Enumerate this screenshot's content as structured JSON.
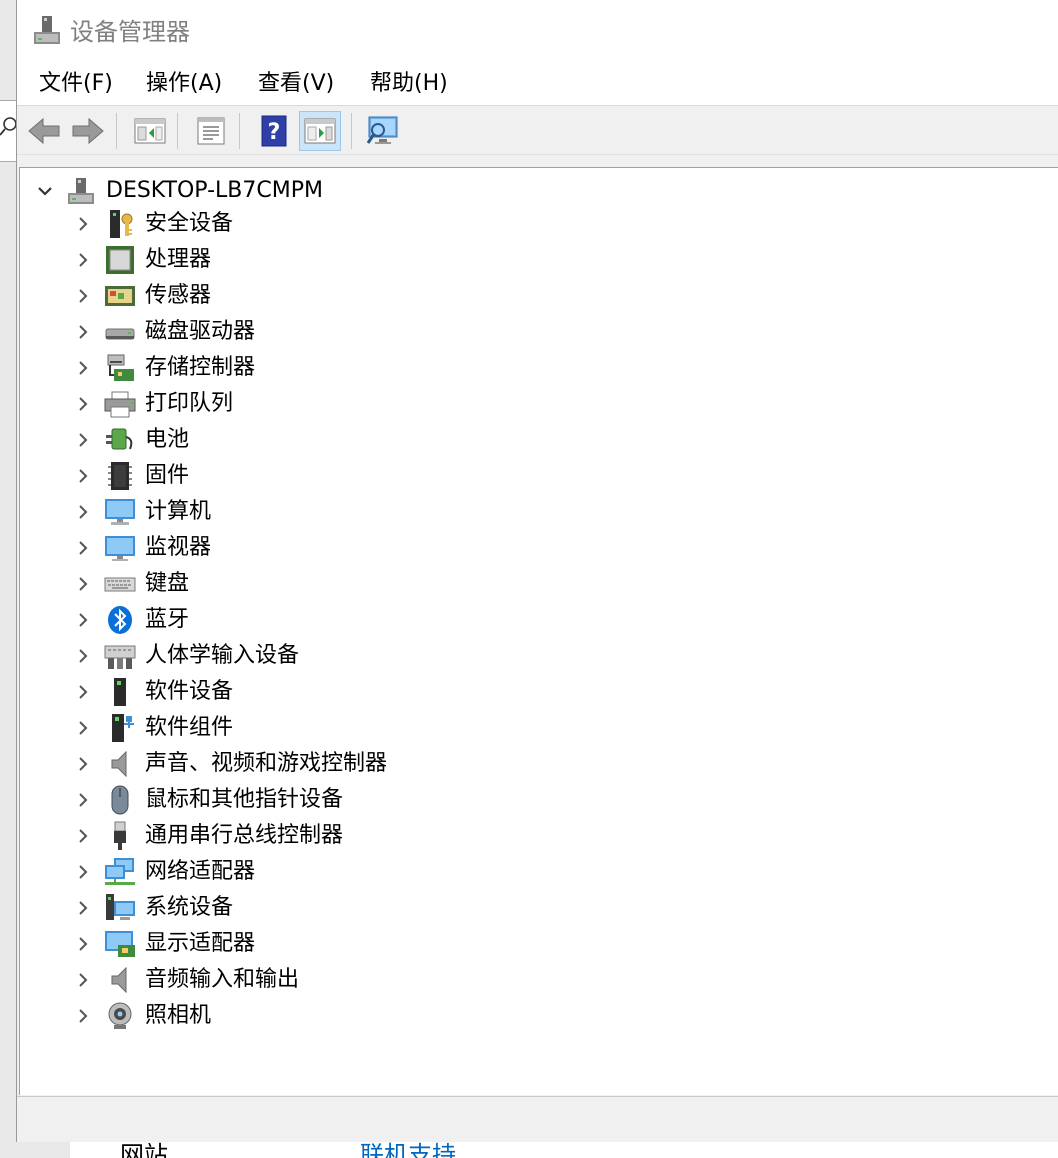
{
  "window": {
    "title": "设备管理器"
  },
  "menu": [
    {
      "label": "文件(F)"
    },
    {
      "label": "操作(A)"
    },
    {
      "label": "查看(V)"
    },
    {
      "label": "帮助(H)"
    }
  ],
  "tree": {
    "root_label": "DESKTOP-LB7CMPM",
    "items": [
      {
        "label": "安全设备",
        "icon": "security-key-icon"
      },
      {
        "label": "处理器",
        "icon": "processor-icon"
      },
      {
        "label": "传感器",
        "icon": "sensor-icon"
      },
      {
        "label": "磁盘驱动器",
        "icon": "disk-drive-icon"
      },
      {
        "label": "存储控制器",
        "icon": "storage-controller-icon"
      },
      {
        "label": "打印队列",
        "icon": "printer-icon"
      },
      {
        "label": "电池",
        "icon": "battery-icon"
      },
      {
        "label": "固件",
        "icon": "firmware-chip-icon"
      },
      {
        "label": "计算机",
        "icon": "computer-monitor-icon"
      },
      {
        "label": "监视器",
        "icon": "monitor-icon"
      },
      {
        "label": "键盘",
        "icon": "keyboard-icon"
      },
      {
        "label": "蓝牙",
        "icon": "bluetooth-icon"
      },
      {
        "label": "人体学输入设备",
        "icon": "hid-icon"
      },
      {
        "label": "软件设备",
        "icon": "software-device-icon"
      },
      {
        "label": "软件组件",
        "icon": "software-component-icon"
      },
      {
        "label": "声音、视频和游戏控制器",
        "icon": "speaker-icon"
      },
      {
        "label": "鼠标和其他指针设备",
        "icon": "mouse-icon"
      },
      {
        "label": "通用串行总线控制器",
        "icon": "usb-plug-icon"
      },
      {
        "label": "网络适配器",
        "icon": "network-adapter-icon"
      },
      {
        "label": "系统设备",
        "icon": "system-device-icon"
      },
      {
        "label": "显示适配器",
        "icon": "display-adapter-icon"
      },
      {
        "label": "音频输入和输出",
        "icon": "audio-io-icon"
      },
      {
        "label": "照相机",
        "icon": "camera-icon"
      }
    ]
  },
  "background_window": {
    "text_left": "网站",
    "text_link": "联机支持"
  },
  "colors": {
    "link_blue": "#0067c0",
    "active_button": "#cce4f7",
    "title_gray": "#808080"
  }
}
